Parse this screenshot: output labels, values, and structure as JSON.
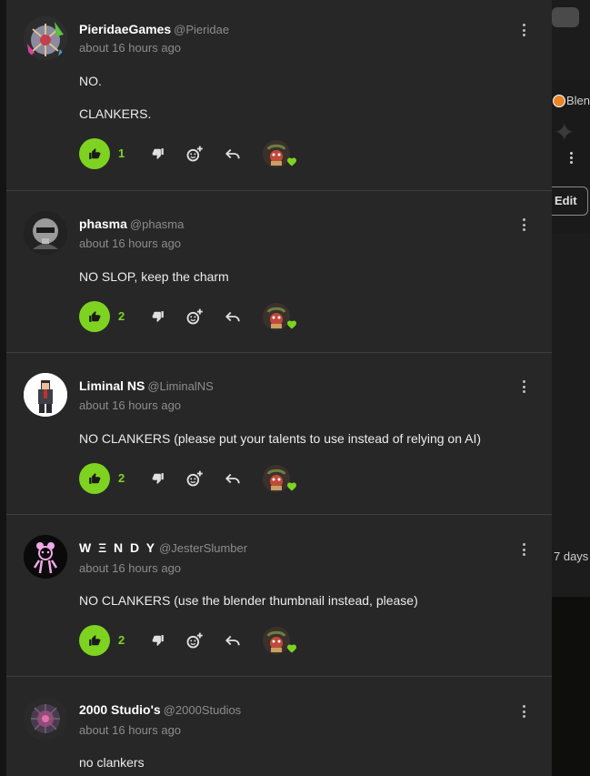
{
  "background_page": {
    "partial_text": "Blen",
    "edit_label": "Edit",
    "days_text": "7 days"
  },
  "accent_color": "#7ed321",
  "comments": [
    {
      "author": "PieridaeGames",
      "handle": "@Pieridae",
      "time": "about 16 hours ago",
      "lines": [
        "NO.",
        "CLANKERS."
      ],
      "likes": "1",
      "liked": true,
      "creator_hearted": true
    },
    {
      "author": "phasma",
      "handle": "@phasma",
      "time": "about 16 hours ago",
      "lines": [
        "NO SLOP, keep the charm"
      ],
      "likes": "2",
      "liked": true,
      "creator_hearted": true
    },
    {
      "author": "Liminal NS",
      "handle": "@LiminalNS",
      "time": "about 16 hours ago",
      "lines": [
        "NO CLANKERS (please put your talents to use instead of relying on AI)"
      ],
      "likes": "2",
      "liked": true,
      "creator_hearted": true
    },
    {
      "author": "W Ξ N D Y",
      "handle": "@JesterSlumber",
      "time": "about 16 hours ago",
      "lines": [
        "NO CLANKERS (use the blender thumbnail instead, please)"
      ],
      "likes": "2",
      "liked": true,
      "creator_hearted": true
    },
    {
      "author": "2000 Studio's",
      "handle": "@2000Studios",
      "time": "about 16 hours ago",
      "lines": [
        "no clankers"
      ]
    }
  ],
  "icons": {
    "like": "thumbs-up-icon",
    "dislike": "thumbs-down-icon",
    "react": "add-reaction-icon",
    "reply": "reply-icon",
    "more": "more-options-icon",
    "heart": "heart-icon"
  }
}
